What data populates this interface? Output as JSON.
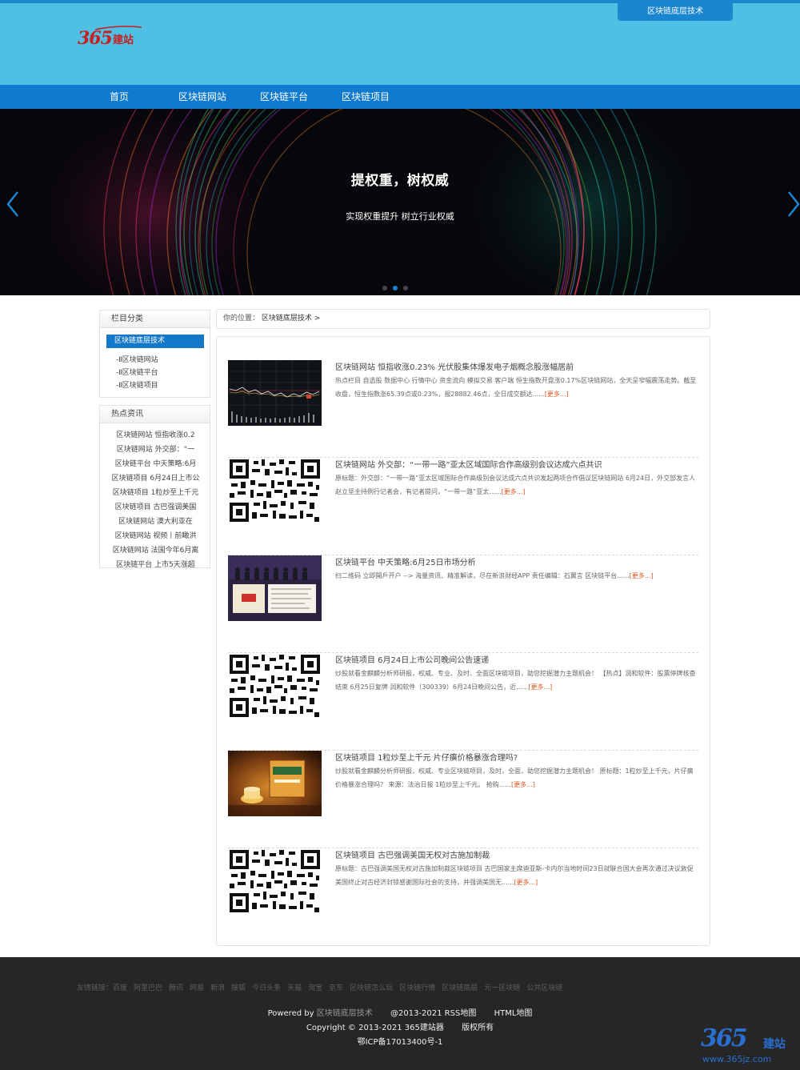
{
  "header": {
    "logo_num": "365",
    "logo_text": "建站",
    "top_tab": "区块链底层技术"
  },
  "nav": [
    "首页",
    "区块链网站",
    "区块链平台",
    "区块链项目"
  ],
  "banner": {
    "title": "提权重，树权威",
    "subtitle": "实现权重提升 树立行业权威",
    "slide_count": 3,
    "active_slide": 2
  },
  "sidebar": {
    "categories_title": "栏目分类",
    "active_category": "区块链底层技术",
    "categories": [
      "-Ⅱ区块链网站",
      "-Ⅱ区块链平台",
      "-Ⅱ区块链项目"
    ],
    "hot_title": "热点资讯",
    "hot_items": [
      "区块链网站 恒指收涨0.2",
      "区块链网站 外交部：“一",
      "区块链平台 中天策略:6月",
      "区块链项目 6月24日上市公",
      "区块链项目 1粒炒至上千元",
      "区块链项目 古巴强调美国",
      "区块链网站 澳大利亚在",
      "区块链网站 视频丨前瞰洪",
      "区块链网站 法国今年6月离",
      "区块链平台 上市5天涨超"
    ]
  },
  "breadcrumb": {
    "prefix": "你的位置：",
    "current": "区块链底层技术 >"
  },
  "articles": [
    {
      "title": "区块链网站 恒指收涨0.23% 光伏股集体爆发电子烟概念股涨幅居前",
      "desc": "热点栏目 自选股 数据中心 行情中心 资金流向 模拟交易 客户端 恒生指数开盘涨0.17%区块链网站，全天呈窄幅震荡走势。截至收盘，恒生指数涨65.39点或0.23%，报28882.46点，全日成交额达......",
      "thumb": "chart-thumbnail"
    },
    {
      "title": "区块链网站 外交部：“一带一路”亚太区域国际合作高级别会议达成六点共识",
      "desc": "原标题：外交部：“一带一路”亚太区域国际合作高级别会议达成六点共识发起两项合作倡议区块链网站 6月24日，外交部发言人赵立坚主持例行记者会，有记者提问，“一带一路”亚太......",
      "thumb": "qr-code"
    },
    {
      "title": "区块链平台 中天策略:6月25日市场分析",
      "desc": "扫二维码 立即開戶开户 --> 海量资讯、精准解读，尽在新浪财经APP 责任编辑：石翼言 区块链平台......",
      "thumb": "meeting-photo"
    },
    {
      "title": "区块链项目 6月24日上市公司晚间公告速递",
      "desc": "炒股就看金麒麟分析师研报，权威、专业、及时、全面区块链项目，助您挖掘潜力主题机会！ 【热点】润和软件：股票停牌核查结束 6月25日复牌 润和软件（300339）6月24日晚间公告，近......",
      "thumb": "qr-code"
    },
    {
      "title": "区块链项目 1粒炒至上千元 片仔癀价格暴涨合理吗?",
      "desc": "炒股就看金麒麟分析师研报，权威、专业区块链项目，及时，全面，助您挖掘潜力主题机会！ 原标题：1粒炒至上千元，片仔癀价格暴涨合理吗？ 来源：法治日报 1粒炒至上千元。 抢购......",
      "thumb": "product-photo"
    },
    {
      "title": "区块链项目 古巴强调美国无权对古施加制裁",
      "desc": "原标题：古巴强调美国无权对古施加制裁区块链项目 古巴国家主席迪亚斯-卡内尔当地时间23日就联合国大会再次通过决议敦促美国终止对古经济封锁感谢国际社会的支持，并强调美国无......",
      "thumb": "qr-code"
    }
  ],
  "more_label": "[更多...]",
  "footer": {
    "friends_label": "友情链接：",
    "friends": [
      "百度",
      "阿里巴巴",
      "腾讯",
      "网易",
      "新浪",
      "搜狐",
      "今日头条",
      "天猫",
      "淘宝",
      "京东",
      "区块链怎么玩",
      "区块链行情",
      "区块链底层",
      "元一区块链",
      "公共区块链"
    ],
    "powered": "Powered by",
    "powered_link": "区块链底层技术",
    "links": [
      "@2013-2021 RSS地图",
      "HTML地图"
    ],
    "copyright": "Copyright © 2013-2021 365建站器",
    "rights": "版权所有",
    "icp": "鄂ICP备17013400号-1",
    "corner_num": "365",
    "corner_text": "建站",
    "corner_url": "www.365jz.com"
  },
  "colors": {
    "header_bg": "#4fbfe3",
    "nav_bg": "#0f7acf",
    "accent": "#1478c8",
    "more": "#e0521f",
    "footer_bg": "#262626"
  }
}
